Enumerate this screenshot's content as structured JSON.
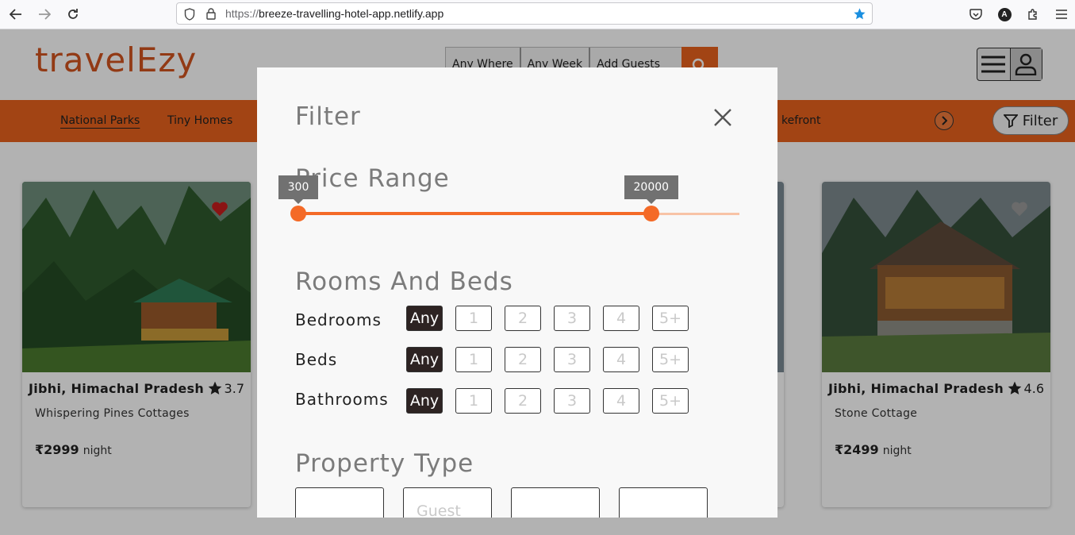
{
  "browser": {
    "url_protocol": "https://",
    "url_host": "breeze-travelling-hotel-app.netlify.app",
    "profile_initial": "A"
  },
  "header": {
    "logo": "travelEzy",
    "search": {
      "where": "Any Where",
      "week": "Any Week",
      "guests": "Add Guests"
    }
  },
  "categories": {
    "items": [
      {
        "label": "National Parks",
        "active": true
      },
      {
        "label": "Tiny Homes",
        "active": false
      }
    ],
    "partial_label": "kefront",
    "filter_label": "Filter"
  },
  "cards": [
    {
      "location": "Jibhi, Himachal Pradesh",
      "rating": "3.7",
      "name": "Whispering Pines Cottages",
      "price": "₹2999",
      "unit": "night",
      "favorite": true
    },
    {
      "location": "Jibhi, Himachal Pradesh",
      "rating": "4.6",
      "name": "Stone Cottage",
      "price": "₹2499",
      "unit": "night",
      "favorite": false
    }
  ],
  "filter_modal": {
    "title": "Filter",
    "price_range": {
      "title": "Price Range",
      "min_label": "300",
      "max_label": "20000",
      "min_fraction": 0.0,
      "max_fraction": 0.8
    },
    "rooms_and_beds": {
      "title": "Rooms And Beds",
      "options": [
        "Any",
        "1",
        "2",
        "3",
        "4",
        "5+"
      ],
      "rows": [
        {
          "label": "Bedrooms",
          "selected": "Any"
        },
        {
          "label": "Beds",
          "selected": "Any"
        },
        {
          "label": "Bathrooms",
          "selected": "Any"
        }
      ]
    },
    "property_type": {
      "title": "Property Type",
      "options": [
        "",
        "Guest",
        "",
        ""
      ]
    }
  },
  "colors": {
    "brand": "#e8621e",
    "slider": "#f46a27",
    "selected": "#2d2322"
  }
}
